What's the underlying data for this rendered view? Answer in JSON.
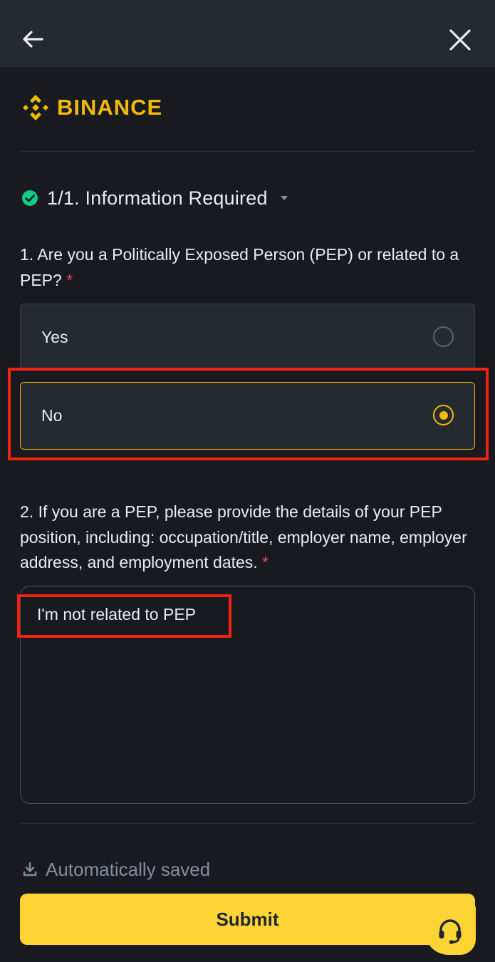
{
  "brand": {
    "name": "BINANCE",
    "color": "#f0b90b"
  },
  "nav": {
    "back_icon": "arrow-left-icon",
    "close_icon": "close-icon"
  },
  "section": {
    "title": "1/1. Information Required",
    "status_icon": "check-circle-icon",
    "toggle_icon": "caret-down-icon"
  },
  "question1": {
    "text": "1. Are you a Politically Exposed Person (PEP) or related to a PEP?",
    "required_mark": "*",
    "options": [
      {
        "label": "Yes",
        "selected": false
      },
      {
        "label": "No",
        "selected": true
      }
    ]
  },
  "question2": {
    "text": "2. If you are a PEP, please provide the details of your PEP position, including: occupation/title, employer name, employer address, and employment dates.",
    "required_mark": "*",
    "answer": "I'm not related to PEP"
  },
  "footer": {
    "autosave_text": "Automatically saved",
    "autosave_icon": "download-icon",
    "submit_label": "Submit",
    "support_icon": "headset-icon"
  },
  "colors": {
    "accent": "#fcd535",
    "background": "#181a20",
    "required": "#f6465d",
    "success": "#0ecb81",
    "highlight": "#f2240f"
  }
}
